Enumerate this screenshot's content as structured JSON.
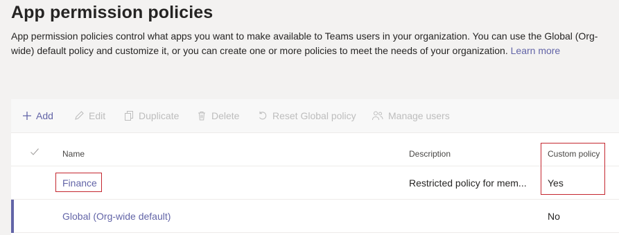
{
  "page": {
    "title": "App permission policies",
    "description": "App permission policies control what apps you want to make available to Teams users in your organization. You can use the Global (Org-wide) default policy and customize it, or you can create one or more policies to meet the needs of your organization.",
    "learn_more": "Learn more"
  },
  "toolbar": {
    "items": [
      {
        "label": "Add",
        "icon": "plus-icon",
        "enabled": true
      },
      {
        "label": "Edit",
        "icon": "pencil-icon",
        "enabled": false
      },
      {
        "label": "Duplicate",
        "icon": "duplicate-icon",
        "enabled": false
      },
      {
        "label": "Delete",
        "icon": "trash-icon",
        "enabled": false
      },
      {
        "label": "Reset Global policy",
        "icon": "reset-icon",
        "enabled": false
      },
      {
        "label": "Manage users",
        "icon": "users-icon",
        "enabled": false
      }
    ]
  },
  "table": {
    "columns": [
      "Name",
      "Description",
      "Custom policy"
    ],
    "rows": [
      {
        "name": "Finance",
        "description": "Restricted policy for mem...",
        "custom": "Yes"
      },
      {
        "name": "Global (Org-wide default)",
        "description": "",
        "custom": "No"
      }
    ]
  },
  "colors": {
    "accent": "#6264a7",
    "highlight_box": "#c4262e",
    "background": "#f3f2f1"
  }
}
